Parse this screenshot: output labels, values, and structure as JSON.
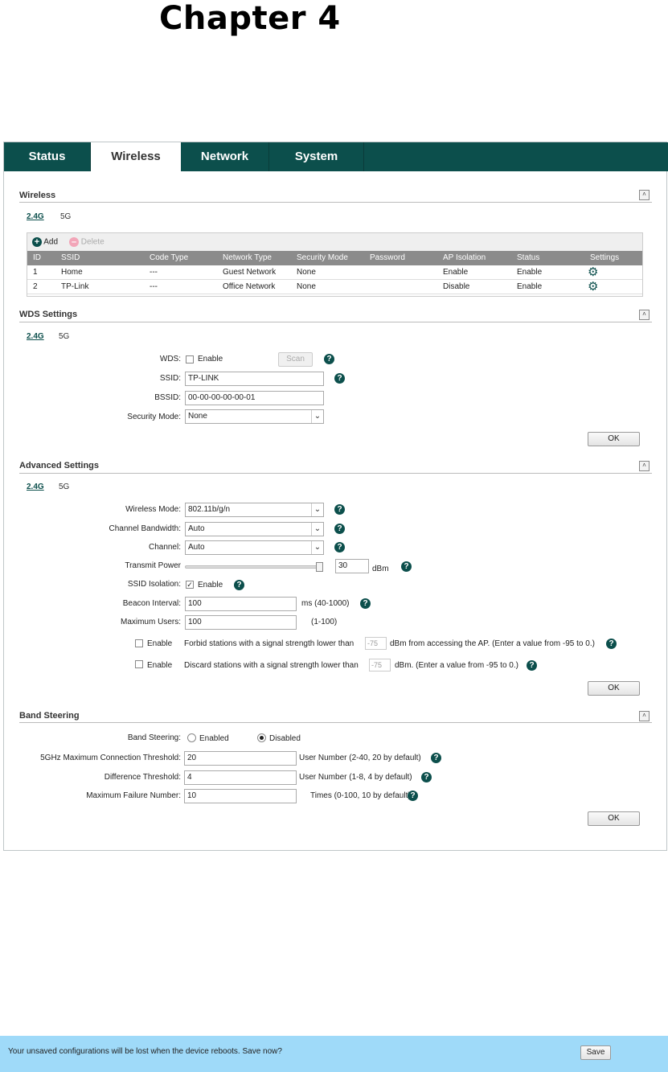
{
  "page": {
    "chapter": "Chapter 4"
  },
  "nav": {
    "tabs": [
      {
        "label": "Status"
      },
      {
        "label": "Wireless"
      },
      {
        "label": "Network"
      },
      {
        "label": "System"
      }
    ]
  },
  "wireless": {
    "title": "Wireless",
    "bands": [
      "2.4G",
      "5G"
    ],
    "toolbar": {
      "add": "Add",
      "delete": "Delete"
    },
    "columns": [
      "ID",
      "SSID",
      "Code Type",
      "Network Type",
      "Security Mode",
      "Password",
      "AP Isolation",
      "Status",
      "Settings"
    ],
    "rows": [
      {
        "id": "1",
        "ssid": "Home",
        "code": "---",
        "network": "Guest Network",
        "security": "None",
        "password": "",
        "isolation": "Enable",
        "status": "Enable"
      },
      {
        "id": "2",
        "ssid": "TP-Link",
        "code": "---",
        "network": "Office Network",
        "security": "None",
        "password": "",
        "isolation": "Disable",
        "status": "Enable"
      }
    ]
  },
  "wds": {
    "title": "WDS Settings",
    "bands": [
      "2.4G",
      "5G"
    ],
    "wds_label": "WDS:",
    "enable_label": "Enable",
    "scan": "Scan",
    "ssid_label": "SSID:",
    "ssid_value": "TP-LINK",
    "bssid_label": "BSSID:",
    "bssid_value": "00-00-00-00-00-01",
    "security_label": "Security Mode:",
    "security_value": "None",
    "ok": "OK"
  },
  "advanced": {
    "title": "Advanced Settings",
    "bands": [
      "2.4G",
      "5G"
    ],
    "mode_label": "Wireless Mode:",
    "mode_value": "802.11b/g/n",
    "bandwidth_label": "Channel Bandwidth:",
    "bandwidth_value": "Auto",
    "channel_label": "Channel:",
    "channel_value": "Auto",
    "power_label": "Transmit Power",
    "power_value": "30",
    "power_unit": "dBm",
    "isolation_label": "SSID Isolation:",
    "isolation_enable": "Enable",
    "beacon_label": "Beacon Interval:",
    "beacon_value": "100",
    "beacon_hint": "ms (40-1000)",
    "users_label": "Maximum Users:",
    "users_value": "100",
    "users_hint": "(1-100)",
    "forbid_enable": "Enable",
    "forbid_pre": "Forbid stations with a signal strength lower than",
    "forbid_value": "-75",
    "forbid_post": "dBm from accessing the AP. (Enter a value from -95 to 0.)",
    "discard_enable": "Enable",
    "discard_pre": "Discard stations with a signal strength lower than",
    "discard_value": "-75",
    "discard_post": "dBm. (Enter a value from -95 to 0.)",
    "ok": "OK"
  },
  "band_steering": {
    "title": "Band Steering",
    "label": "Band Steering:",
    "enabled": "Enabled",
    "disabled": "Disabled",
    "threshold_label": "5GHz Maximum Connection Threshold:",
    "threshold_value": "20",
    "threshold_hint": "User Number (2-40, 20 by default)",
    "diff_label": "Difference Threshold:",
    "diff_value": "4",
    "diff_hint": "User Number (1-8, 4 by default)",
    "fail_label": "Maximum Failure Number:",
    "fail_value": "10",
    "fail_hint": "Times (0-100, 10 by default)",
    "ok": "OK"
  },
  "footer": {
    "message": "Your unsaved configurations will be lost when the device reboots. Save now?",
    "save": "Save"
  }
}
